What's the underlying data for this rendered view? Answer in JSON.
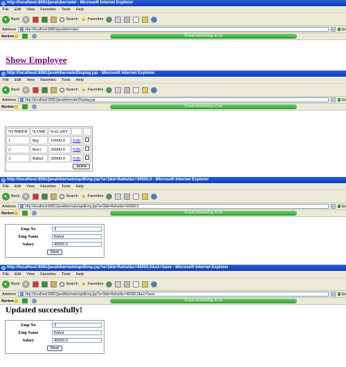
{
  "menu": [
    "File",
    "Edit",
    "View",
    "Favorites",
    "Tools",
    "Help"
  ],
  "toolbar": {
    "back": "Back",
    "search": "Search",
    "favorites": "Favorites"
  },
  "address_label": "Address",
  "go_label": "Go",
  "norton": {
    "brand": "Norton",
    "fraud": "Fraud monitoring is on"
  },
  "windows": [
    {
      "title": "http://localhost:8081/javahibernate/ - Microsoft Internet Explorer",
      "url": "http://localhost:8081/javahibernate/"
    },
    {
      "title": "http://localhost:8081/javahibernate/Display.jsp - Microsoft Internet Explorer",
      "url": "http://localhost:8081/javahibernate/Display.jsp"
    },
    {
      "title": "http://localhost:8081/javahibernate/updEmp.jsp?a=3&b=Rahul&c=30000.0 - Microsoft Internet Explorer",
      "url": "http://localhost:8081/javahibernate/updEmp.jsp?a=3&b=Rahul&c=30000.0"
    },
    {
      "title": "http://localhost:8081/javahibernate/updEmp.jsp?a=3&b=Rahul&c=40000.0&a1=Save - Microsoft Internet Explorer",
      "url": "http://localhost:8081/javahibernate/updEmp.jsp?a=3&b=Rahul&c=40000.0&a1=Save"
    }
  ],
  "page1": {
    "heading": "Show Employee"
  },
  "page2": {
    "headers": [
      "NUMBER",
      "NAME",
      "SALARY"
    ],
    "rows": [
      {
        "num": "1",
        "name": "Raj",
        "salary": "10000.0",
        "edit": "Edit"
      },
      {
        "num": "2",
        "name": "Ravi",
        "salary": "20000.0",
        "edit": "Edit"
      },
      {
        "num": "3",
        "name": "Rahul",
        "salary": "30000.0",
        "edit": "Edit"
      }
    ],
    "delete": "delete"
  },
  "form3": {
    "no_label": "Emp No",
    "name_label": "Emp Name",
    "salary_label": "Salary",
    "no": "3",
    "name": "Rahul",
    "salary": "40000.0",
    "save": "Save"
  },
  "page4": {
    "heading": "Updated successfully!"
  },
  "form4": {
    "no_label": "Emp No",
    "name_label": "Emp Name",
    "salary_label": "Salary",
    "no": "3",
    "name": "Rahul",
    "salary": "40000.0",
    "save": "Save"
  }
}
